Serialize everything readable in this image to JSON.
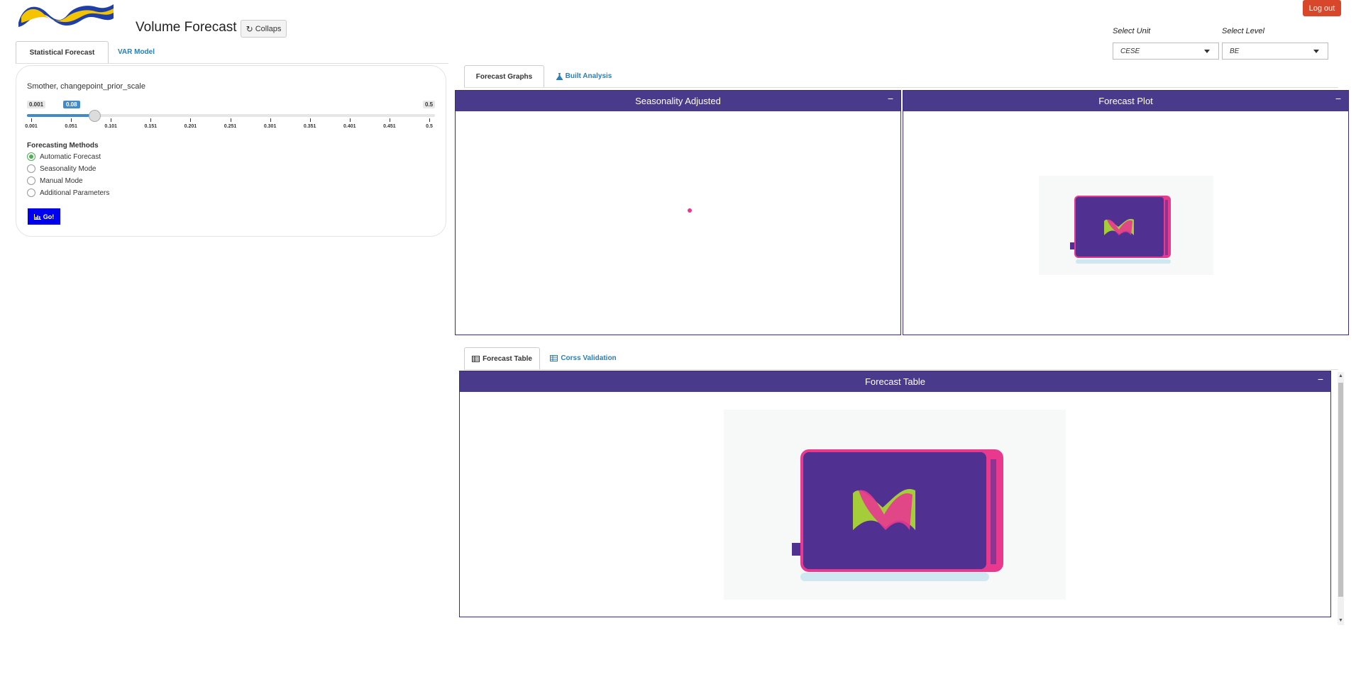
{
  "header": {
    "title": "Volume Forecast",
    "collapse_label": "Collaps",
    "logout_label": "Log out"
  },
  "selectors": {
    "unit_label": "Select Unit",
    "unit_value": "CESE",
    "level_label": "Select Level",
    "level_value": "BE"
  },
  "main_tabs": [
    {
      "label": "Statistical Forecast",
      "active": true
    },
    {
      "label": "VAR Model",
      "active": false
    }
  ],
  "sidebar": {
    "slider": {
      "label": "Smother, changepoint_prior_scale",
      "min": "0.001",
      "max": "0.5",
      "value": "0.08",
      "fraction": 0.158,
      "ticks": [
        "0.001",
        "0.051",
        "0.101",
        "0.151",
        "0.201",
        "0.251",
        "0.301",
        "0.351",
        "0.401",
        "0.451",
        "0.5"
      ]
    },
    "methods_title": "Forecasting Methods",
    "methods": [
      {
        "label": "Automatic Forecast",
        "selected": true
      },
      {
        "label": "Seasonality Mode",
        "selected": false
      },
      {
        "label": "Manual Mode",
        "selected": false
      },
      {
        "label": "Additional Parameters",
        "selected": false
      }
    ],
    "go_label": "Go!"
  },
  "graph_tabs": [
    {
      "label": "Forecast Graphs",
      "active": true
    },
    {
      "label": "Built Analysis",
      "active": false,
      "icon": "flask-icon"
    }
  ],
  "boxes": {
    "seasonality": {
      "title": "Seasonality Adjusted",
      "minimize": "−"
    },
    "forecast_plot": {
      "title": "Forecast Plot",
      "minimize": "−"
    },
    "forecast_table": {
      "title": "Forecast Table",
      "minimize": "−"
    }
  },
  "table_tabs": [
    {
      "label": "Forecast Table",
      "active": true,
      "icon": "table-icon"
    },
    {
      "label": "Corss Validation",
      "active": false,
      "icon": "table-icon"
    }
  ],
  "colors": {
    "box_header": "#4a3a8c",
    "accent_blue": "#428bca",
    "logout": "#d9472b",
    "go_button": "#0000ee",
    "loader_pink": "#e8398f",
    "loader_purple": "#503091",
    "loader_green": "#a5cd39"
  }
}
